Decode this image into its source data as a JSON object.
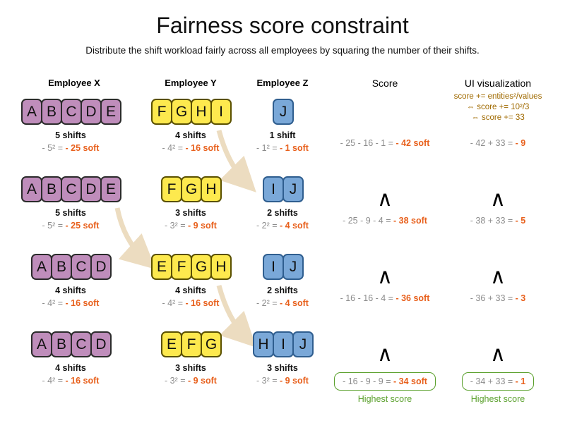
{
  "title": "Fairness score constraint",
  "subtitle": "Distribute the shift workload fairly across all employees by squaring the number of their shifts.",
  "headers": {
    "employee_x": "Employee X",
    "employee_y": "Employee Y",
    "employee_z": "Employee Z",
    "score": "Score",
    "ui_visualization": "UI visualization"
  },
  "formula": {
    "line1": "score += entities²/values",
    "line2": "⇔ score += 10²/3",
    "line3": "⇔ score += 33",
    "color": "#a06a00"
  },
  "colors": {
    "purple": "#bf8dbb",
    "yellow": "#fde94e",
    "blue": "#7aa8d8",
    "highlight": "#e8601c",
    "muted": "#8c8c8c",
    "green": "#5aa02c",
    "arrow": "#ecdcc0"
  },
  "rows": [
    {
      "x": {
        "letters": [
          "A",
          "B",
          "C",
          "D",
          "E"
        ],
        "count": "5 shifts",
        "soft_prefix": "- 5² = ",
        "soft_value": "- 25 soft"
      },
      "y": {
        "letters": [
          "F",
          "G",
          "H",
          "I"
        ],
        "count": "4 shifts",
        "soft_prefix": "- 4² = ",
        "soft_value": "- 16 soft"
      },
      "z": {
        "letters": [
          "J"
        ],
        "count": "1 shift",
        "soft_prefix": "- 1² = ",
        "soft_value": "- 1 soft"
      },
      "score": {
        "prefix": "- 25 - 16 - 1 = ",
        "value": "- 42 soft",
        "caret": false
      },
      "ui": {
        "prefix": "- 42 + 33 = ",
        "value": "- 9",
        "caret": false
      },
      "best": false
    },
    {
      "x": {
        "letters": [
          "A",
          "B",
          "C",
          "D",
          "E"
        ],
        "count": "5 shifts",
        "soft_prefix": "- 5² = ",
        "soft_value": "- 25 soft"
      },
      "y": {
        "letters": [
          "F",
          "G",
          "H"
        ],
        "count": "3 shifts",
        "soft_prefix": "- 3² = ",
        "soft_value": "- 9 soft"
      },
      "z": {
        "letters": [
          "I",
          "J"
        ],
        "count": "2 shifts",
        "soft_prefix": "- 2² = ",
        "soft_value": "- 4 soft"
      },
      "score": {
        "prefix": "- 25 - 9 - 4 = ",
        "value": "- 38 soft",
        "caret": true
      },
      "ui": {
        "prefix": "- 38 + 33 = ",
        "value": "- 5",
        "caret": true
      },
      "best": false
    },
    {
      "x": {
        "letters": [
          "A",
          "B",
          "C",
          "D"
        ],
        "count": "4 shifts",
        "soft_prefix": "- 4² = ",
        "soft_value": "- 16 soft"
      },
      "y": {
        "letters": [
          "E",
          "F",
          "G",
          "H"
        ],
        "count": "4 shifts",
        "soft_prefix": "- 4² = ",
        "soft_value": "- 16 soft"
      },
      "z": {
        "letters": [
          "I",
          "J"
        ],
        "count": "2 shifts",
        "soft_prefix": "- 2² = ",
        "soft_value": "- 4 soft"
      },
      "score": {
        "prefix": "- 16 - 16 - 4 = ",
        "value": "- 36 soft",
        "caret": true
      },
      "ui": {
        "prefix": "- 36 + 33 = ",
        "value": "- 3",
        "caret": true
      },
      "best": false
    },
    {
      "x": {
        "letters": [
          "A",
          "B",
          "C",
          "D"
        ],
        "count": "4 shifts",
        "soft_prefix": "- 4² = ",
        "soft_value": "- 16 soft"
      },
      "y": {
        "letters": [
          "E",
          "F",
          "G"
        ],
        "count": "3 shifts",
        "soft_prefix": "- 3² = ",
        "soft_value": "- 9 soft"
      },
      "z": {
        "letters": [
          "H",
          "I",
          "J"
        ],
        "count": "3 shifts",
        "soft_prefix": "- 3² = ",
        "soft_value": "- 9 soft"
      },
      "score": {
        "prefix": "- 16 - 9 - 9 = ",
        "value": "- 34 soft",
        "caret": true
      },
      "ui": {
        "prefix": "- 34 + 33 = ",
        "value": "- 1",
        "caret": true
      },
      "best": true,
      "best_label": "Highest score"
    }
  ],
  "caret_symbol": "∧"
}
